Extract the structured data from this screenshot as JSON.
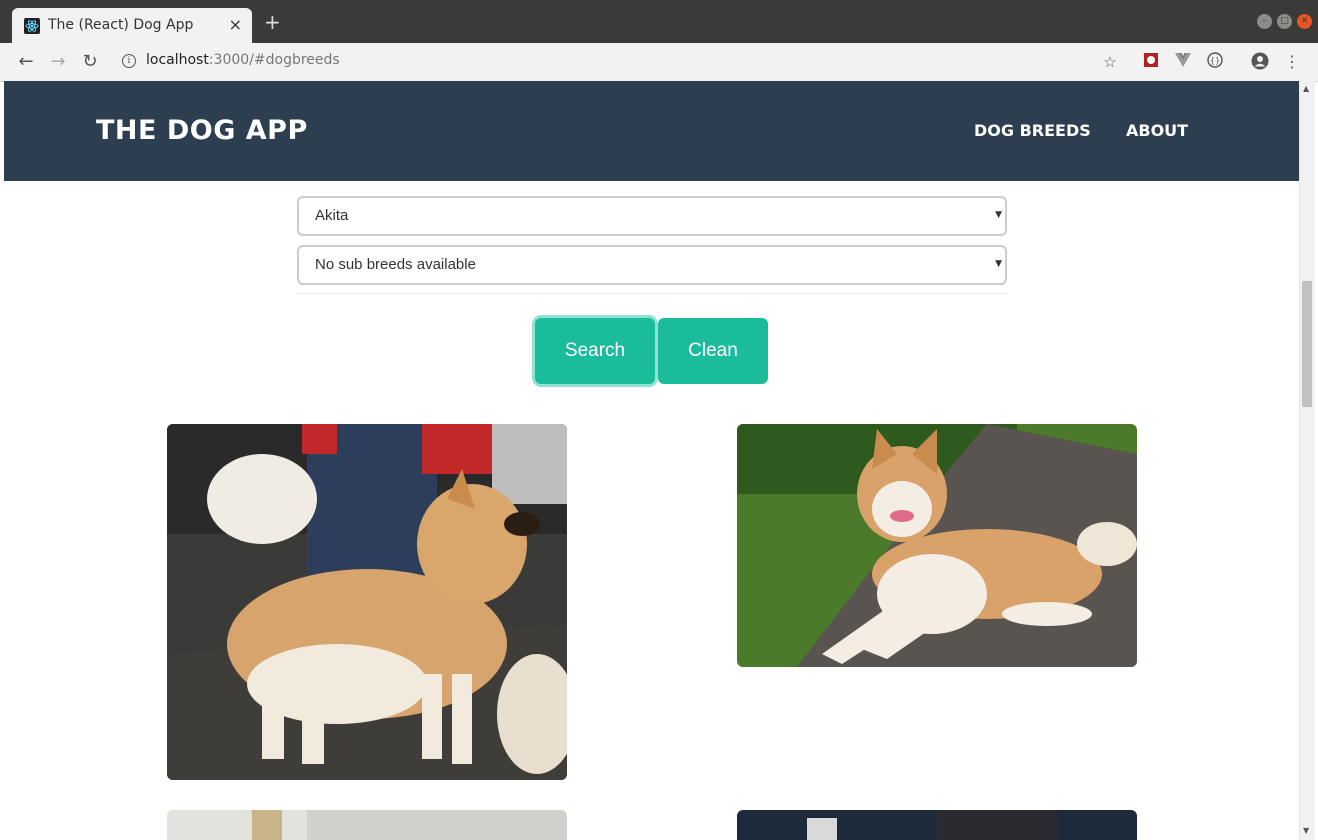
{
  "browser": {
    "tab_title": "The (React) Dog App",
    "url_host": "localhost",
    "url_path": ":3000/#dogbreeds",
    "new_tab": "+",
    "close": "×"
  },
  "app": {
    "brand": "THE DOG APP",
    "nav": [
      "DOG BREEDS",
      "ABOUT"
    ]
  },
  "filters": {
    "breed_value": "Akita",
    "sub_breed_value": "No sub breeds available"
  },
  "buttons": {
    "search": "Search",
    "clean": "Clean"
  },
  "colors": {
    "header": "#2c3e50",
    "accent": "#1abc9c"
  }
}
